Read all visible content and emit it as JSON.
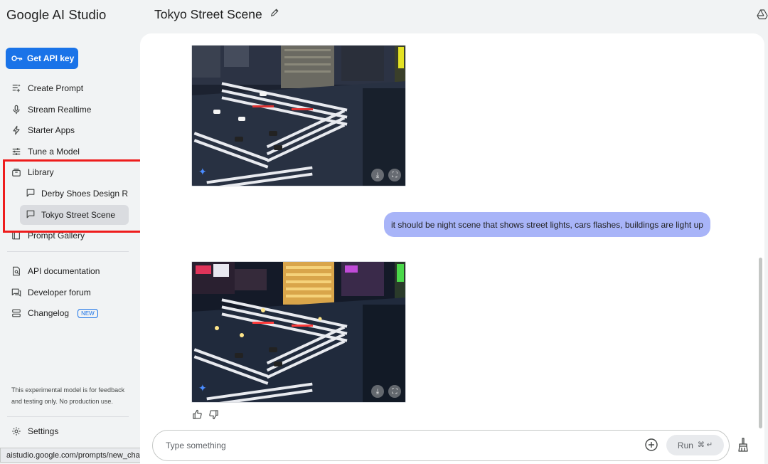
{
  "app": {
    "brand": "Google AI Studio"
  },
  "sidebar": {
    "api_key_label": "Get API key",
    "items": [
      {
        "label": "Create Prompt",
        "icon": "create-prompt-icon"
      },
      {
        "label": "Stream Realtime",
        "icon": "mic-icon"
      },
      {
        "label": "Starter Apps",
        "icon": "bolt-icon"
      },
      {
        "label": "Tune a Model",
        "icon": "tune-icon"
      },
      {
        "label": "Library",
        "icon": "library-icon"
      },
      {
        "label": "Prompt Gallery",
        "icon": "gallery-icon"
      },
      {
        "label": "API documentation",
        "icon": "docs-icon"
      },
      {
        "label": "Developer forum",
        "icon": "forum-icon"
      },
      {
        "label": "Changelog",
        "icon": "changelog-icon",
        "badge": "NEW"
      },
      {
        "label": "Settings",
        "icon": "gear-icon"
      }
    ],
    "library_items": [
      {
        "label": "Derby Shoes Design R..."
      },
      {
        "label": "Tokyo Street Scene",
        "active": true
      }
    ],
    "disclaimer": "This experimental model is for feedback and testing only. No production use.",
    "status_url": "aistudio.google.com/prompts/new_chat"
  },
  "header": {
    "title": "Tokyo Street Scene"
  },
  "chat": {
    "user_message": "it should be night scene that shows street lights, cars flashes, buildings are light up"
  },
  "input": {
    "placeholder": "Type something",
    "run_label": "Run",
    "run_shortcut": "⌘ ↵"
  },
  "colors": {
    "accent": "#1a73e8",
    "user_bubble": "#a8b4f8",
    "highlight_box": "#ee1c1c"
  }
}
